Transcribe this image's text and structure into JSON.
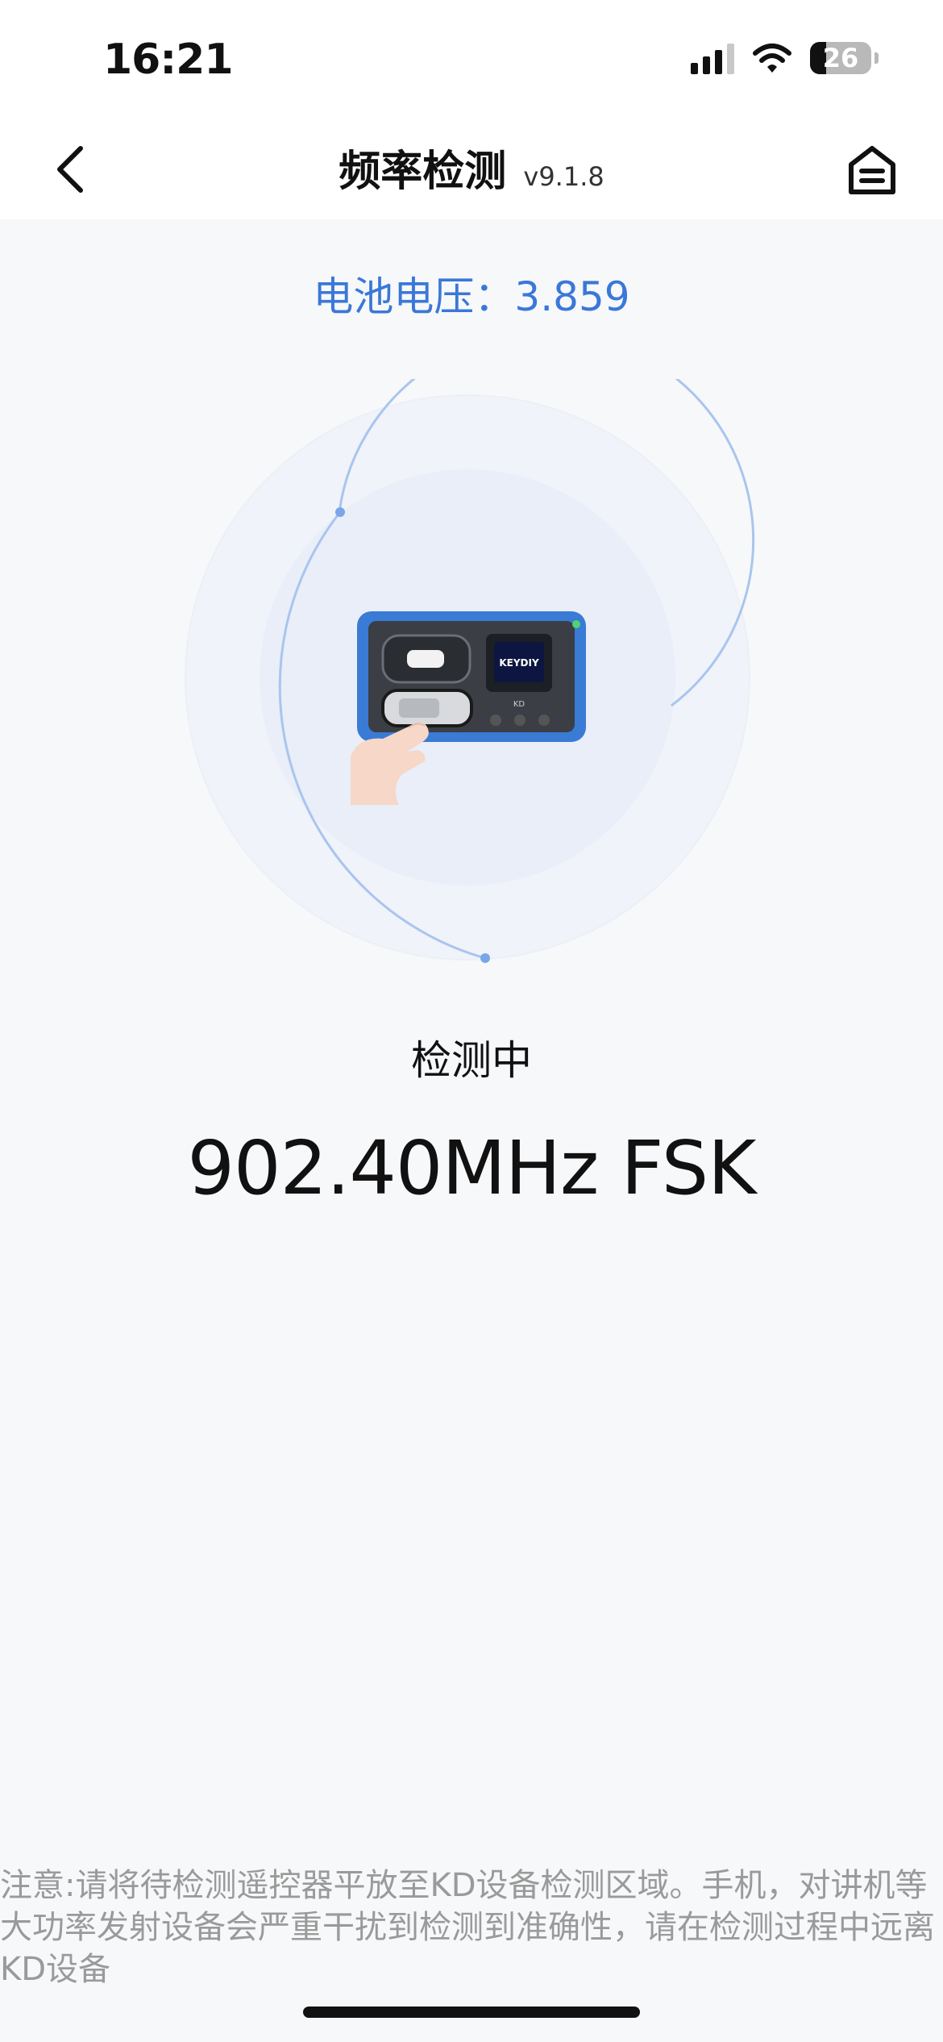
{
  "status_bar": {
    "time": "16:21",
    "battery_level": "26",
    "icons": [
      "signal-icon",
      "wifi-icon",
      "battery-icon"
    ]
  },
  "nav": {
    "title": "频率检测",
    "version": "v9.1.8",
    "back_icon": "chevron-left-icon",
    "home_icon": "home-icon"
  },
  "battery_voltage": "电池电压：3.859",
  "detection": {
    "status": "检测中",
    "frequency": "902.40MHz FSK"
  },
  "device_image": {
    "brand": "KEYDIY",
    "model": "KD"
  },
  "notice": "注意:请将待检测遥控器平放至KD设备检测区域。手机，对讲机等大功率发射设备会严重干扰到检测到准确性，请在检测过程中远离KD设备",
  "colors": {
    "accent": "#3a78d8",
    "ring": "#a9c5ee",
    "device_blue": "#3a7bd5"
  }
}
